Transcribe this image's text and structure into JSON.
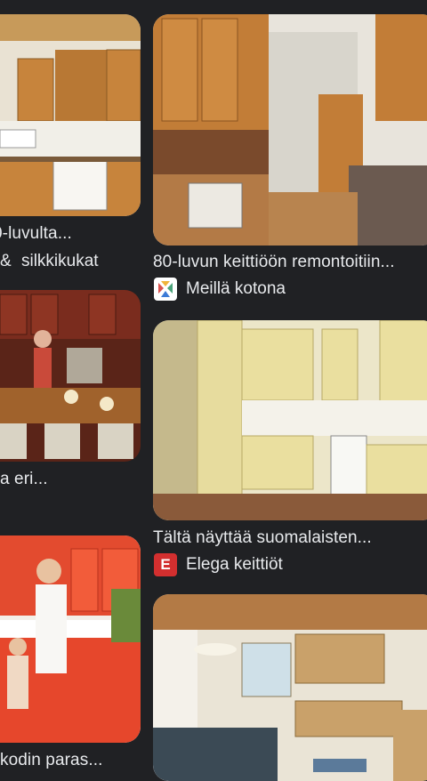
{
  "results": [
    {
      "title": "0-luvulta...",
      "source": "silkkikukat"
    },
    {
      "title": "80-luvun keittiöön remontoitiin...",
      "source": "Meillä kotona",
      "favicon": "meilla-kotona-icon"
    },
    {
      "title": "a eri..."
    },
    {
      "title": "Tältä näyttää suomalaisten...",
      "source": "Elega keittiöt",
      "favicon": "elega-e-icon",
      "favicon_letter": "E"
    },
    {
      "title": "kodin paras..."
    }
  ],
  "left_prefix": "&",
  "colors": {
    "background": "#202124",
    "text": "#e8eaed",
    "elega": "#d32f2f"
  }
}
